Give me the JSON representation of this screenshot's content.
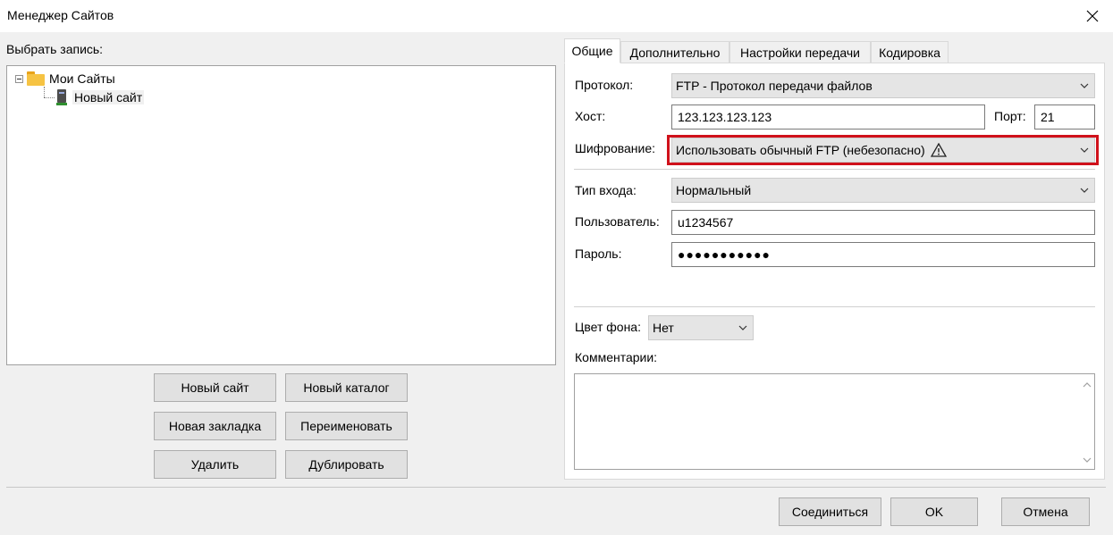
{
  "window": {
    "title": "Менеджер Сайтов"
  },
  "left": {
    "select_label": "Выбрать запись:",
    "tree": {
      "root": "Мои Сайты",
      "child": "Новый сайт"
    },
    "buttons": {
      "new_site": "Новый сайт",
      "new_folder": "Новый каталог",
      "new_bookmark": "Новая закладка",
      "rename": "Переименовать",
      "delete": "Удалить",
      "duplicate": "Дублировать"
    }
  },
  "tabs": [
    "Общие",
    "Дополнительно",
    "Настройки передачи",
    "Кодировка"
  ],
  "form": {
    "protocol_label": "Протокол:",
    "protocol_value": "FTP - Протокол передачи файлов",
    "host_label": "Хост:",
    "host_value": "123.123.123.123",
    "port_label": "Порт:",
    "port_value": "21",
    "encryption_label": "Шифрование:",
    "encryption_value": "Использовать обычный FTP (небезопасно)",
    "logon_label": "Тип входа:",
    "logon_value": "Нормальный",
    "user_label": "Пользователь:",
    "user_value": "u1234567",
    "password_label": "Пароль:",
    "password_value": "●●●●●●●●●●●",
    "bgcolor_label": "Цвет фона:",
    "bgcolor_value": "Нет",
    "comments_label": "Комментарии:"
  },
  "footer": {
    "connect": "Соединиться",
    "ok": "OK",
    "cancel": "Отмена"
  },
  "colors": {
    "highlight": "#d0111b"
  }
}
